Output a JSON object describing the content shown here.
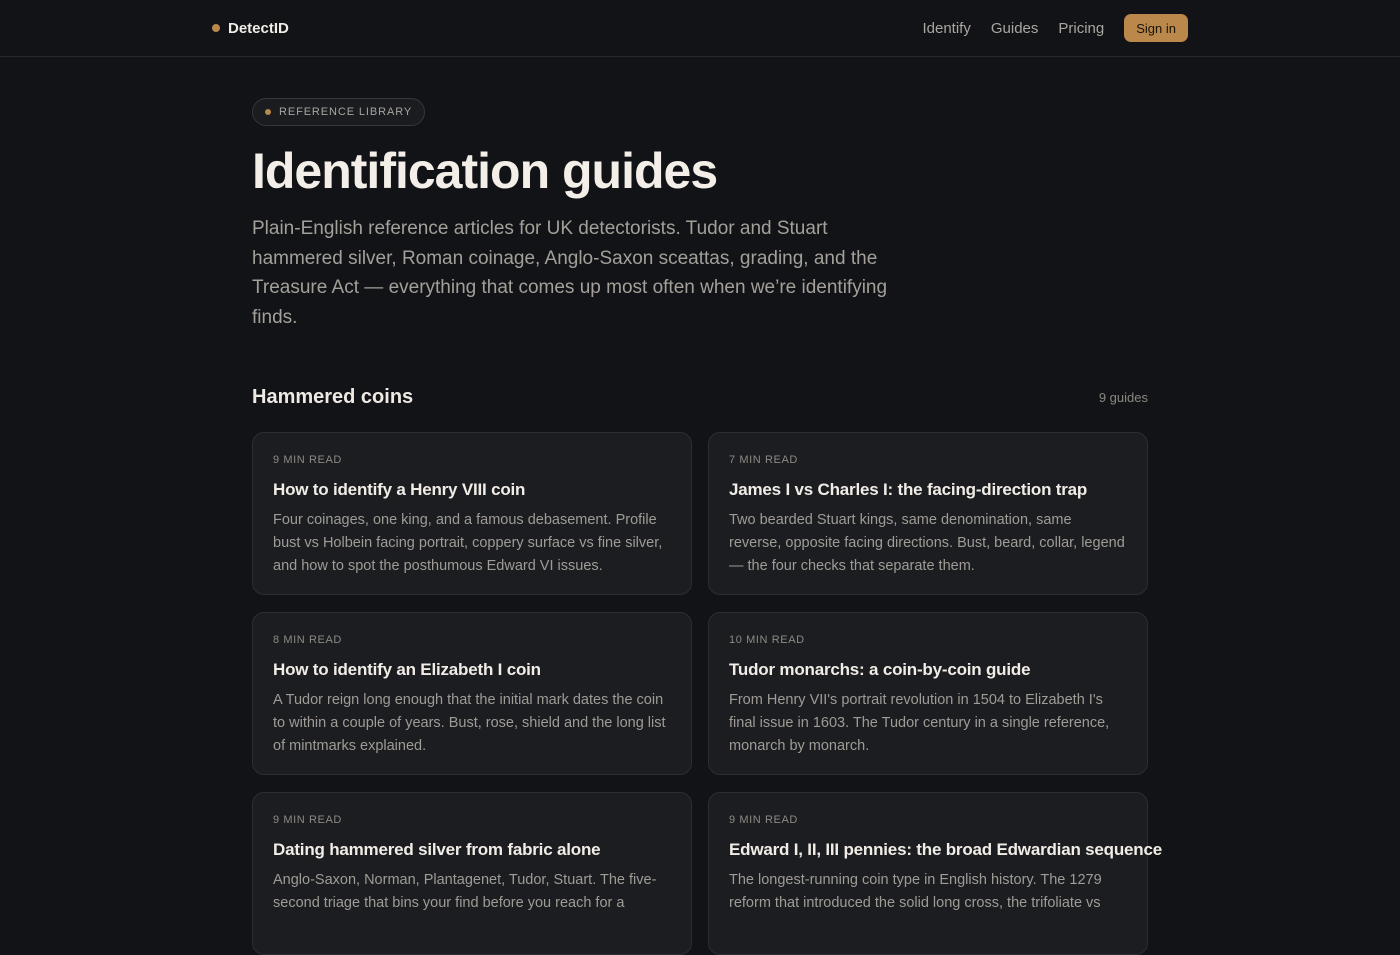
{
  "nav": {
    "brand": "DetectID",
    "links": [
      "Identify",
      "Guides",
      "Pricing"
    ],
    "signin": "Sign in"
  },
  "hero": {
    "eyebrow": "REFERENCE LIBRARY",
    "title": "Identification guides",
    "lead": "Plain-English reference articles for UK detectorists. Tudor and Stuart hammered silver, Roman coinage, Anglo-Saxon sceattas, grading, and the Treasure Act — everything that comes up most often when we’re identifying finds."
  },
  "section": {
    "title": "Hammered coins",
    "count": "9 guides"
  },
  "cards": [
    {
      "meta": "9 MIN READ",
      "title": "How to identify a Henry VIII coin",
      "desc": "Four coinages, one king, and a famous debasement. Profile bust vs Holbein facing portrait, coppery surface vs fine silver, and how to spot the posthumous Edward VI issues."
    },
    {
      "meta": "7 MIN READ",
      "title": "James I vs Charles I: the facing-direction trap",
      "desc": "Two bearded Stuart kings, same denomination, same reverse, opposite facing directions. Bust, beard, collar, legend — the four checks that separate them."
    },
    {
      "meta": "8 MIN READ",
      "title": "How to identify an Elizabeth I coin",
      "desc": "A Tudor reign long enough that the initial mark dates the coin to within a couple of years. Bust, rose, shield and the long list of mintmarks explained."
    },
    {
      "meta": "10 MIN READ",
      "title": "Tudor monarchs: a coin-by-coin guide",
      "desc": "From Henry VII's portrait revolution in 1504 to Elizabeth I's final issue in 1603. The Tudor century in a single reference, monarch by monarch."
    },
    {
      "meta": "9 MIN READ",
      "title": "Dating hammered silver from fabric alone",
      "desc": "Anglo-Saxon, Norman, Plantagenet, Tudor, Stuart. The five-second triage that bins your find before you reach for a"
    },
    {
      "meta": "9 MIN READ",
      "title": "Edward I, II, III pennies: the broad Edwardian sequence",
      "desc": "The longest-running coin type in English history. The 1279 reform that introduced the solid long cross, the trifoliate vs"
    }
  ]
}
